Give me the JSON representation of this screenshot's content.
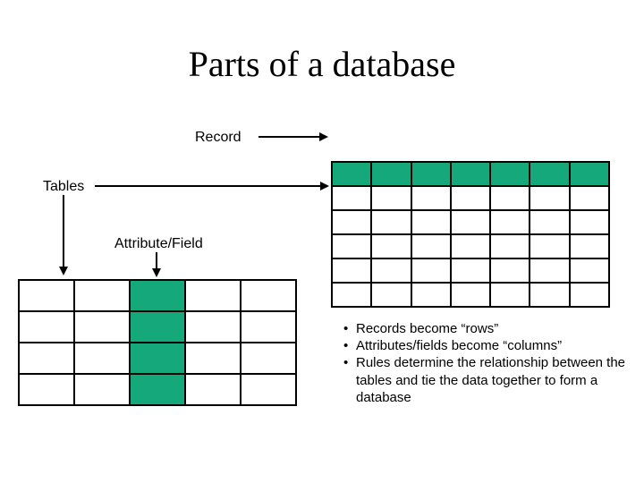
{
  "title": "Parts of a database",
  "labels": {
    "record": "Record",
    "tables": "Tables",
    "attribute_field": "Attribute/Field"
  },
  "bullets": [
    "Records become “rows”",
    "Attributes/fields become “columns”",
    "Rules determine the relationship between the tables and tie the data together to form a database"
  ],
  "colors": {
    "accent": "#14a87b"
  },
  "tables": {
    "right": {
      "rows": 6,
      "cols": 7,
      "highlighted_row_index": 0
    },
    "left": {
      "rows": 4,
      "cols": 5,
      "highlighted_col_index": 2
    }
  }
}
